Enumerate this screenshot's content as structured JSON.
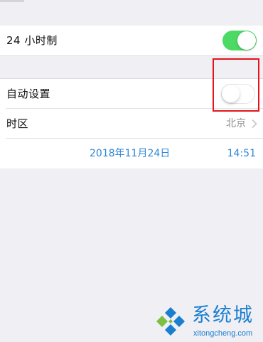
{
  "settings": {
    "hour_24_label": "24 小时制",
    "hour_24_enabled": true,
    "auto_set_label": "自动设置",
    "auto_set_enabled": false,
    "timezone_label": "时区",
    "timezone_value": "北京"
  },
  "datetime": {
    "date": "2018年11月24日",
    "time": "14:51"
  },
  "watermark": {
    "title": "系统城",
    "url": "xitongcheng.com"
  },
  "colors": {
    "switch_on": "#4cd964",
    "date_time_text": "#2d87d6",
    "highlight_box": "#e3141c",
    "watermark_blue": "#1b7fd0",
    "watermark_green": "#79c043"
  },
  "icons": {
    "chevron": "chevron-right-icon",
    "logo": "xitongcheng-logo-icon"
  }
}
